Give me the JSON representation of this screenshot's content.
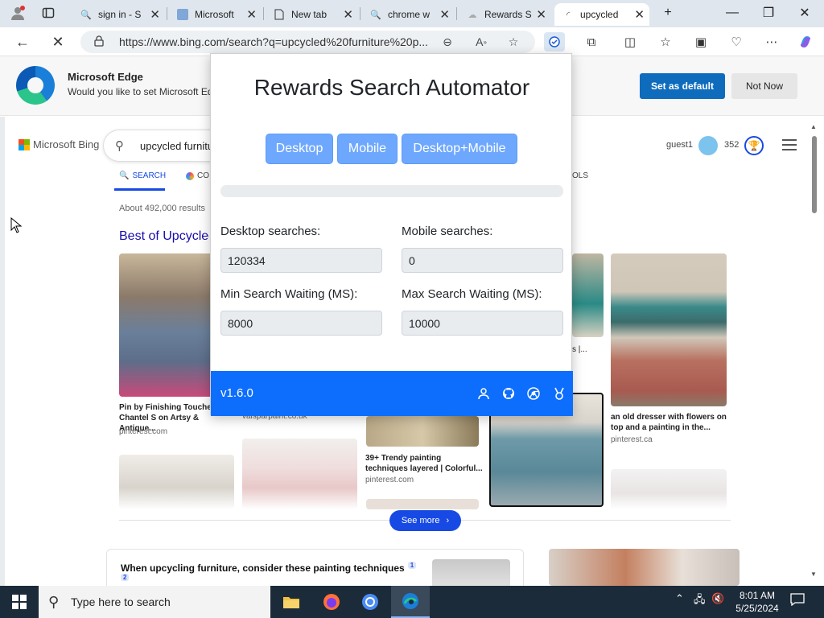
{
  "browser": {
    "tabs": [
      {
        "label": "sign in - S"
      },
      {
        "label": "Microsoft"
      },
      {
        "label": "New tab"
      },
      {
        "label": "chrome w"
      },
      {
        "label": "Rewards S"
      },
      {
        "label": "upcycled"
      }
    ],
    "url": "https://www.bing.com/search?q=upcycled%20furniture%20p..."
  },
  "banner": {
    "title": "Microsoft Edge",
    "message": "Would you like to set Microsoft Edge as your default browser?",
    "set_default": "Set as default",
    "not_now": "Not Now"
  },
  "bing": {
    "brand": "Microsoft Bing",
    "query": "upcycled furniture",
    "nav": {
      "search": "SEARCH",
      "copilot": "CO",
      "tools": "OLS"
    },
    "result_count": "About 492,000 results",
    "section_title": "Best of Upcycled",
    "user": "guest1",
    "points": "352",
    "images": [
      {
        "caption": "Pin by Finishing Touches - Chantel S on Artsy & Antique...",
        "source": "pinterest.com"
      },
      {
        "caption": "",
        "source": "valsparpaint.co.uk"
      },
      {
        "caption": "39+ Trendy painting techniques layered | Colorful...",
        "source": "pinterest.com"
      },
      {
        "caption": "s |...",
        "source": ""
      },
      {
        "caption": "an old dresser with flowers on top and a painting in the...",
        "source": "pinterest.ca"
      }
    ],
    "see_more": "See more",
    "card_title": "When upcycling furniture, consider these painting techniques",
    "card_sup1": "1",
    "card_sup2": "2"
  },
  "extension": {
    "title": "Rewards Search Automator",
    "buttons": {
      "desktop": "Desktop",
      "mobile": "Mobile",
      "both": "Desktop+Mobile"
    },
    "progress": 0,
    "fields": {
      "desktop_label": "Desktop searches:",
      "desktop_value": "120334",
      "mobile_label": "Mobile searches:",
      "mobile_value": "0",
      "min_label": "Min Search Waiting (MS):",
      "min_value": "8000",
      "max_label": "Max Search Waiting (MS):",
      "max_value": "10000"
    },
    "version": "v1.6.0"
  },
  "taskbar": {
    "search_placeholder": "Type here to search",
    "time": "8:01 AM",
    "date": "5/25/2024"
  },
  "colors": {
    "accent": "#0d6efd",
    "button": "#6ea8fe",
    "bing_blue": "#174ae4",
    "taskbar": "#1c2b3a"
  }
}
